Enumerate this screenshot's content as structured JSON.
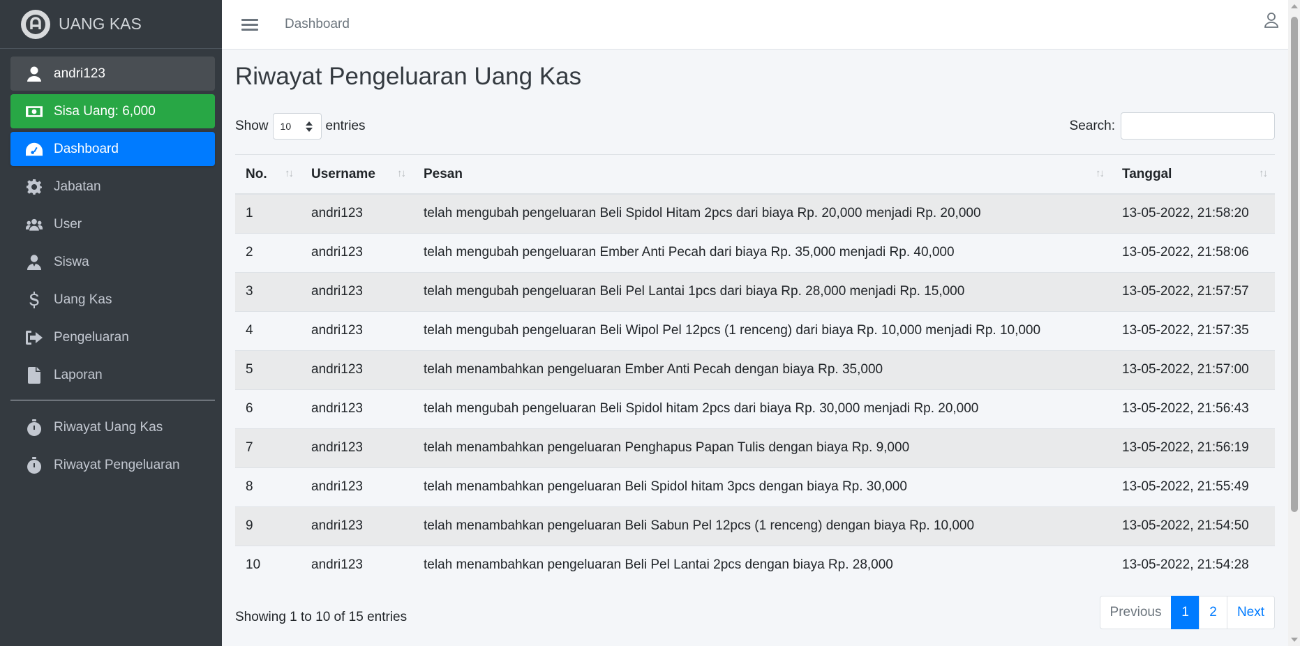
{
  "brand": {
    "name": "UANG KAS"
  },
  "sidebar": {
    "user": "andri123",
    "balance": "Sisa Uang: 6,000",
    "items": [
      {
        "label": "Dashboard",
        "icon": "tachometer-icon"
      },
      {
        "label": "Jabatan",
        "icon": "gear-icon"
      },
      {
        "label": "User",
        "icon": "users-icon"
      },
      {
        "label": "Siswa",
        "icon": "user-tie-icon"
      },
      {
        "label": "Uang Kas",
        "icon": "dollar-icon"
      },
      {
        "label": "Pengeluaran",
        "icon": "sign-out-icon"
      },
      {
        "label": "Laporan",
        "icon": "file-icon"
      }
    ],
    "history": [
      {
        "label": "Riwayat Uang Kas",
        "icon": "stopwatch-icon"
      },
      {
        "label": "Riwayat Pengeluaran",
        "icon": "stopwatch-icon"
      }
    ]
  },
  "topbar": {
    "link": "Dashboard"
  },
  "page": {
    "title": "Riwayat Pengeluaran Uang Kas"
  },
  "controls": {
    "show_label": "Show",
    "length_value": "10",
    "entries_label": "entries",
    "search_label": "Search:"
  },
  "table": {
    "columns": [
      "No.",
      "Username",
      "Pesan",
      "Tanggal"
    ],
    "rows": [
      [
        "1",
        "andri123",
        "telah mengubah pengeluaran Beli Spidol Hitam 2pcs dari biaya Rp. 20,000 menjadi Rp. 20,000",
        "13-05-2022, 21:58:20"
      ],
      [
        "2",
        "andri123",
        "telah mengubah pengeluaran Ember Anti Pecah dari biaya Rp. 35,000 menjadi Rp. 40,000",
        "13-05-2022, 21:58:06"
      ],
      [
        "3",
        "andri123",
        "telah mengubah pengeluaran Beli Pel Lantai 1pcs dari biaya Rp. 28,000 menjadi Rp. 15,000",
        "13-05-2022, 21:57:57"
      ],
      [
        "4",
        "andri123",
        "telah mengubah pengeluaran Beli Wipol Pel 12pcs (1 renceng) dari biaya Rp. 10,000 menjadi Rp. 10,000",
        "13-05-2022, 21:57:35"
      ],
      [
        "5",
        "andri123",
        "telah menambahkan pengeluaran Ember Anti Pecah dengan biaya Rp. 35,000",
        "13-05-2022, 21:57:00"
      ],
      [
        "6",
        "andri123",
        "telah mengubah pengeluaran Beli Spidol hitam 2pcs dari biaya Rp. 30,000 menjadi Rp. 20,000",
        "13-05-2022, 21:56:43"
      ],
      [
        "7",
        "andri123",
        "telah menambahkan pengeluaran Penghapus Papan Tulis dengan biaya Rp. 9,000",
        "13-05-2022, 21:56:19"
      ],
      [
        "8",
        "andri123",
        "telah menambahkan pengeluaran Beli Spidol hitam 3pcs dengan biaya Rp. 30,000",
        "13-05-2022, 21:55:49"
      ],
      [
        "9",
        "andri123",
        "telah menambahkan pengeluaran Beli Sabun Pel 12pcs (1 renceng) dengan biaya Rp. 10,000",
        "13-05-2022, 21:54:50"
      ],
      [
        "10",
        "andri123",
        "telah menambahkan pengeluaran Beli Pel Lantai 2pcs dengan biaya Rp. 28,000",
        "13-05-2022, 21:54:28"
      ]
    ]
  },
  "footer": {
    "info": "Showing 1 to 10 of 15 entries"
  },
  "pagination": {
    "previous": "Previous",
    "pages": [
      "1",
      "2"
    ],
    "next": "Next",
    "active": "1"
  },
  "colors": {
    "sidebar_bg": "#343a40",
    "active": "#007bff",
    "success": "#28a745"
  }
}
